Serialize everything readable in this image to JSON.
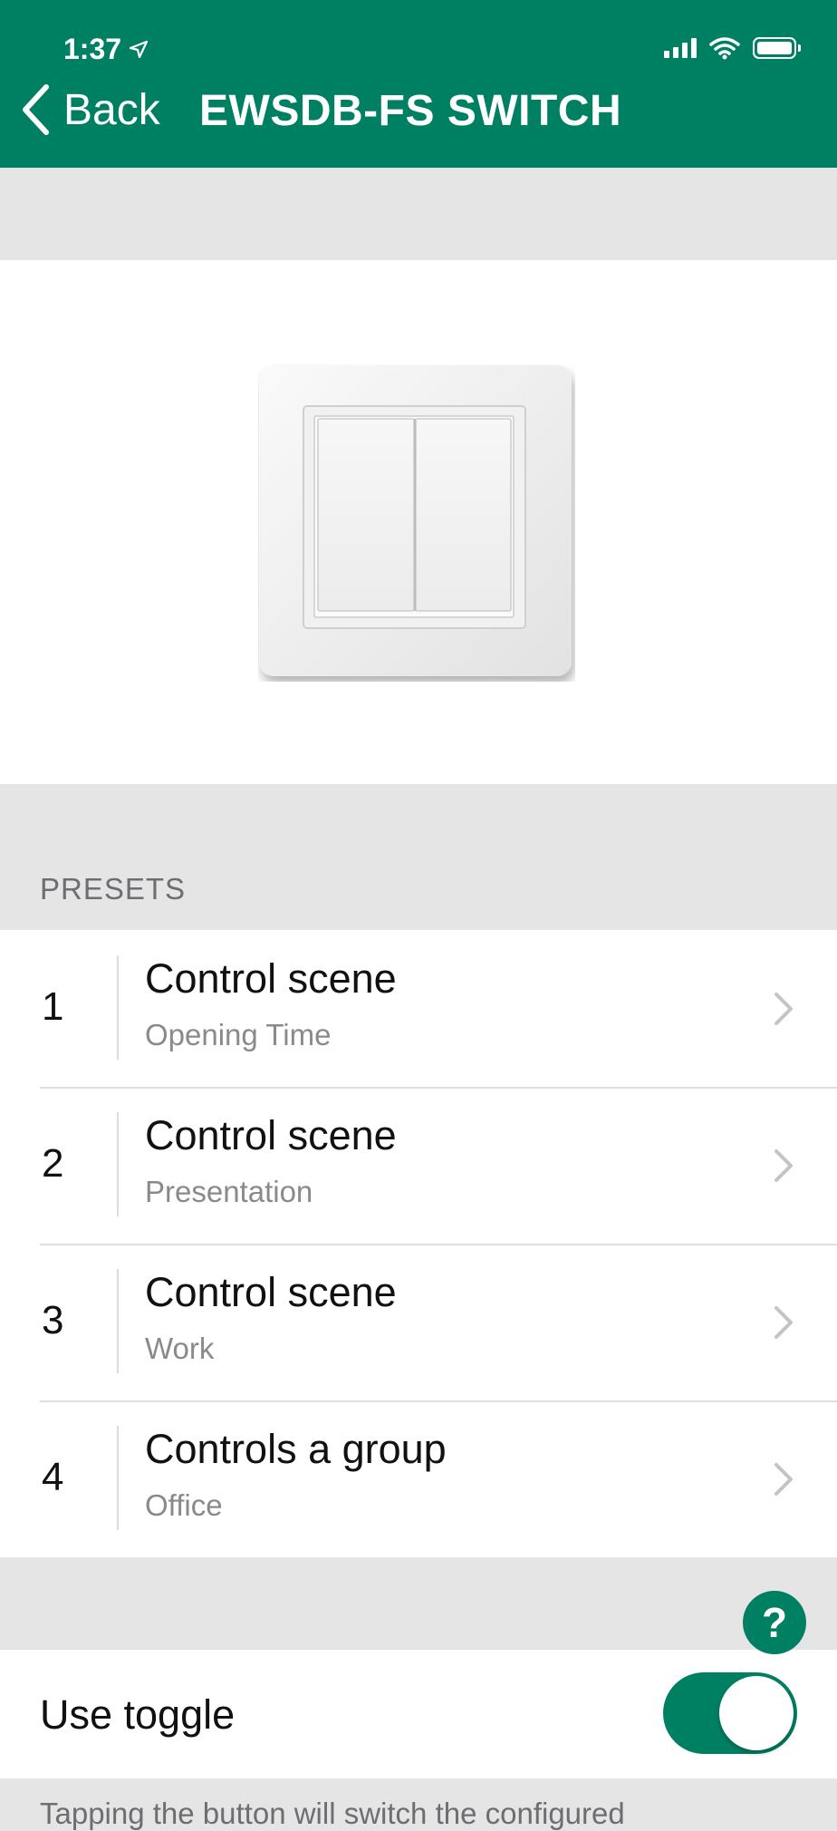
{
  "status_bar": {
    "time": "1:37"
  },
  "nav": {
    "back_label": "Back",
    "title": "EWSDB-FS SWITCH"
  },
  "presets": {
    "header": "PRESETS",
    "items": [
      {
        "number": "1",
        "title": "Control scene",
        "subtitle": "Opening Time"
      },
      {
        "number": "2",
        "title": "Control scene",
        "subtitle": "Presentation"
      },
      {
        "number": "3",
        "title": "Control scene",
        "subtitle": "Work"
      },
      {
        "number": "4",
        "title": "Controls a group",
        "subtitle": "Office"
      }
    ]
  },
  "help_button": {
    "label": "?"
  },
  "toggle": {
    "label": "Use toggle",
    "on": true
  },
  "footer": {
    "text": "Tapping the button will switch the configured"
  },
  "colors": {
    "accent": "#008063",
    "background": "#e5e5e5"
  }
}
